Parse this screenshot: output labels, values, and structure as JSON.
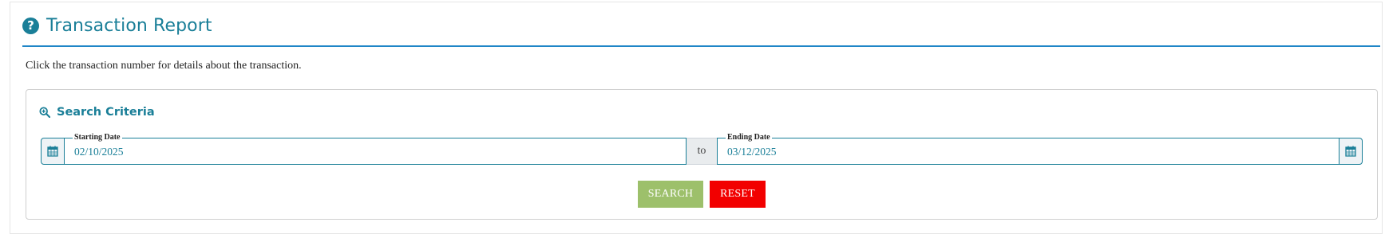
{
  "header": {
    "icon": "question-circle-icon",
    "title": "Transaction Report"
  },
  "intro_text": "Click the transaction number for details about the transaction.",
  "search_criteria": {
    "icon": "search-plus-icon",
    "title": "Search Criteria",
    "starting_date": {
      "label": "Starting Date",
      "value": "02/10/2025",
      "icon": "calendar-icon"
    },
    "separator": "to",
    "ending_date": {
      "label": "Ending Date",
      "value": "03/12/2025",
      "icon": "calendar-icon"
    },
    "buttons": {
      "search_label": "SEARCH",
      "reset_label": "RESET"
    }
  },
  "colors": {
    "accent": "#1a7f98",
    "rule": "#1f86c7",
    "search_button": "#9dc06b",
    "reset_button": "#f20000"
  }
}
